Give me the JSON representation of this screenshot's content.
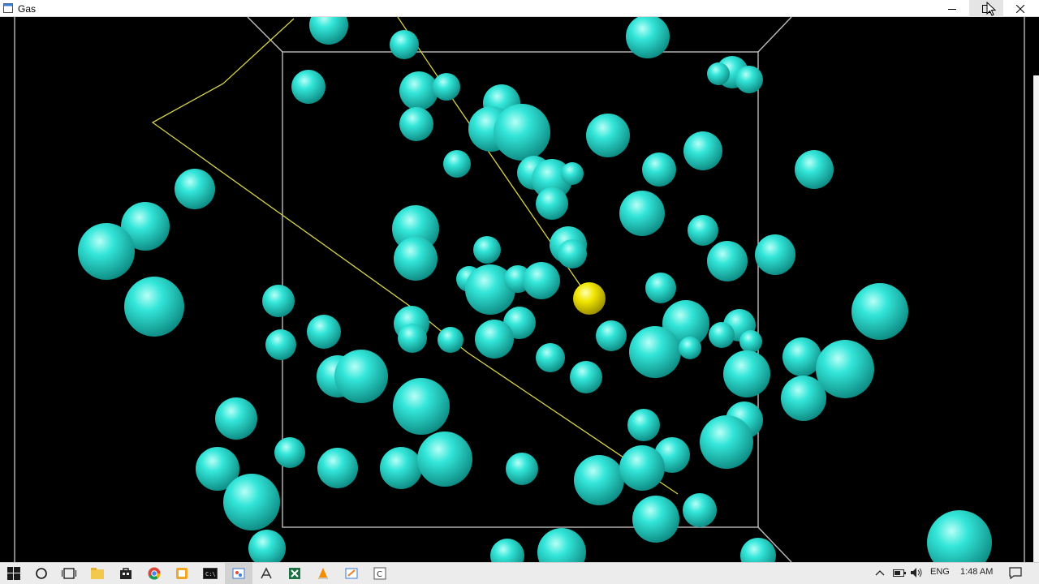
{
  "window": {
    "title": "Gas",
    "icon": "window-app-icon",
    "controls": [
      "minimize-icon",
      "maximize-icon",
      "close-icon"
    ]
  },
  "scene": {
    "background": "#000000",
    "box_color": "#bdbdbd",
    "particle_color": "#33e6d9",
    "tracked_particle_color": "#f2e600",
    "trail_color": "#d8d24a"
  },
  "taskbar": {
    "apps": [
      "start-icon",
      "search-icon",
      "task-view-icon",
      "file-explorer-icon",
      "store-icon",
      "chrome-icon",
      "app-orange-icon",
      "terminal-icon",
      "paint-icon",
      "network-tool-icon",
      "excel-icon",
      "vlc-icon",
      "paint-2-icon",
      "app-c-icon"
    ],
    "tray": {
      "language": "ENG",
      "time": "1:48 AM"
    }
  }
}
